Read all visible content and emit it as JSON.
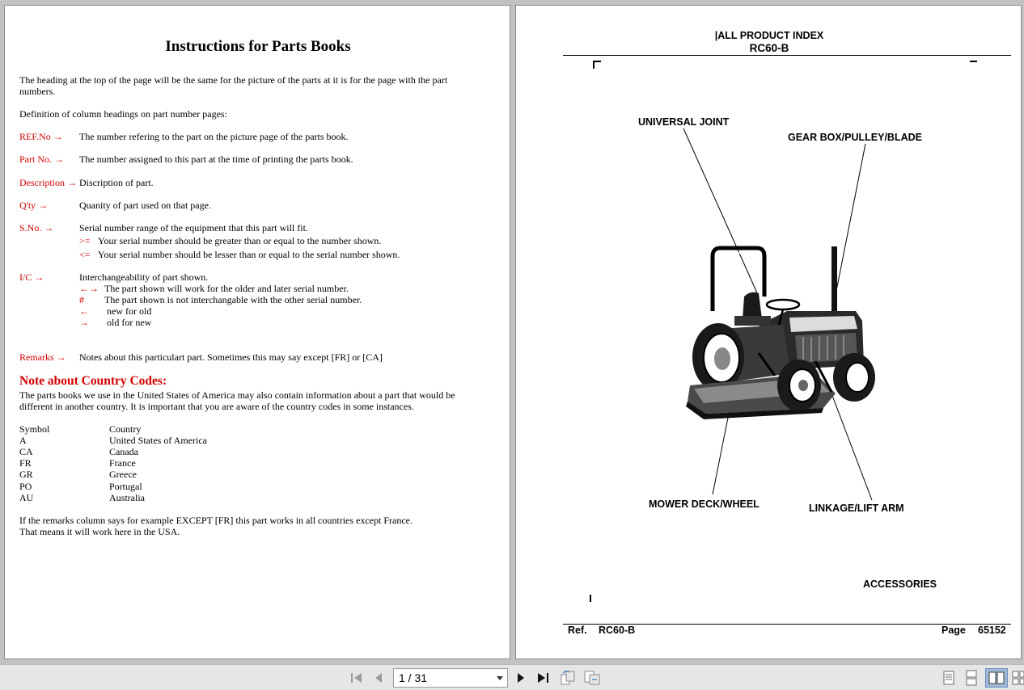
{
  "left_page": {
    "title": "Instructions for Parts Books",
    "intro_line1": "The heading at the top of the page will be the same for the picture of the parts at it is for the page with the part",
    "intro_line2": "numbers.",
    "definition_heading": "Definition of column headings on part number pages:",
    "rows": [
      {
        "label": "REF.No",
        "arrow": "→",
        "text": "The number refering to the part on the picture page of the parts book."
      },
      {
        "label": "Part No.",
        "arrow": "→",
        "text": "The number assigned to this part at the time of printing the parts book."
      },
      {
        "label": "Description",
        "arrow": "→",
        "text": "Discription of part."
      },
      {
        "label": "Q'ty",
        "arrow": "→",
        "text": "Quanity of part used on that page."
      },
      {
        "label": "S.No.",
        "arrow": "→",
        "text": "Serial number range of the equipment that this part will fit."
      }
    ],
    "sno_sub": [
      {
        "symbol": ">=",
        "text": "Your serial number should be greater than or equal to the number shown."
      },
      {
        "symbol": "<=",
        "text": "Your serial number should be lesser than or equal to the serial number shown."
      }
    ],
    "ic": {
      "label": "I/C",
      "arrow": "→",
      "text": "Interchangeability of part shown.",
      "sub": [
        {
          "symbol": "←→",
          "text": "The part shown will work for the older and later serial number."
        },
        {
          "symbol": "#",
          "text": "The part shown is not interchangable with the other serial number."
        },
        {
          "symbol": "←",
          "text": "new for old"
        },
        {
          "symbol": "→",
          "text": "old for new"
        }
      ]
    },
    "remarks": {
      "label": "Remarks",
      "arrow": "→",
      "text": "Notes about this particulart part. Sometimes this may say except [FR] or [CA]"
    },
    "note_heading": "Note about Country Codes:",
    "note_line1": "The parts books we use in the United States of America may also contain information about a part that would be",
    "note_line2": "different in another country. It is important that you are aware of the country codes in some instances.",
    "country_table": {
      "headers": [
        "Symbol",
        "Country"
      ],
      "rows": [
        [
          "A",
          "United States of America"
        ],
        [
          "CA",
          "Canada"
        ],
        [
          "FR",
          "France"
        ],
        [
          "GR",
          "Greece"
        ],
        [
          "PO",
          "Portugal"
        ],
        [
          "AU",
          "Australia"
        ]
      ]
    },
    "footer_line1": "If the remarks column says for example EXCEPT [FR] this part works in all countries except France.",
    "footer_line2": "That means it will work here in the USA."
  },
  "right_page": {
    "header_title": "|ALL PRODUCT INDEX",
    "header_model": "RC60-B",
    "callouts": {
      "universal_joint": "UNIVERSAL JOINT",
      "gear_box": "GEAR BOX/PULLEY/BLADE",
      "mower_deck": "MOWER DECK/WHEEL",
      "linkage": "LINKAGE/LIFT ARM",
      "accessories": "ACCESSORIES"
    },
    "footer": {
      "ref_label": "Ref.",
      "ref_value": "RC60-B",
      "page_label": "Page",
      "page_value": "65152"
    }
  },
  "toolbar": {
    "page_indicator": "1 / 31",
    "icons": [
      "first-page-icon",
      "prev-page-icon",
      "next-page-icon",
      "last-page-icon",
      "rotate-icon",
      "fit-icon",
      "single-page-view-icon",
      "continuous-view-icon",
      "two-page-view-icon",
      "two-page-continuous-icon"
    ]
  },
  "colors": {
    "accent_red": "#d40000",
    "background": "#c2c2c2",
    "toolbar": "#e6e6e6",
    "active_view": "#9fb8d8"
  }
}
